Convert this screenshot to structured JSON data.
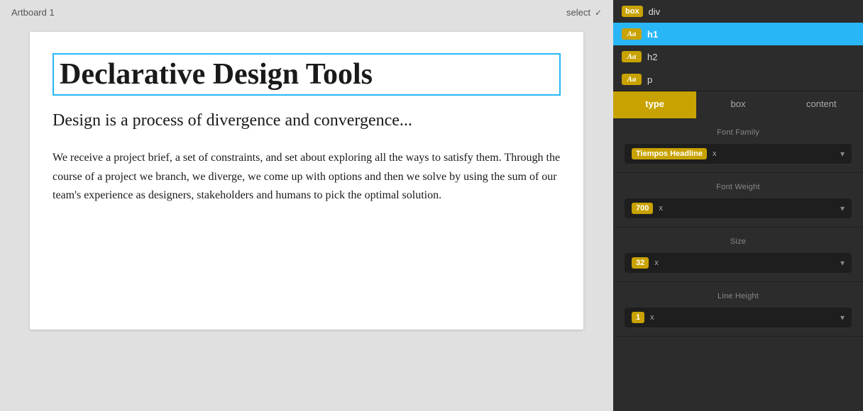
{
  "canvas": {
    "artboard_label": "Artboard 1",
    "select_label": "select",
    "h1_text": "Declarative Design Tools",
    "h2_text": "Design is a process of divergence and convergence...",
    "p_text": "We receive a project brief, a set of constraints, and set about exploring all the ways to satisfy them. Through the course of a project we branch, we diverge, we come up with options and then we solve by using the sum of our team's experience as designers, stakeholders and humans to pick the optimal solution."
  },
  "panel": {
    "elements": [
      {
        "id": "div",
        "badge": "box",
        "label": "div",
        "active": false
      },
      {
        "id": "h1",
        "badge": "Aa",
        "label": "h1",
        "active": true
      },
      {
        "id": "h2",
        "badge": "Aa",
        "label": "h2",
        "active": false
      },
      {
        "id": "p",
        "badge": "Aa",
        "label": "p",
        "active": false
      }
    ],
    "tabs": [
      {
        "id": "type",
        "label": "type",
        "active": true
      },
      {
        "id": "box",
        "label": "box",
        "active": false
      },
      {
        "id": "content",
        "label": "content",
        "active": false
      }
    ],
    "sections": [
      {
        "id": "font-family",
        "label": "Font Family",
        "tag": "Tiempos Headline",
        "x": "x",
        "chevron": "▾"
      },
      {
        "id": "font-weight",
        "label": "Font Weight",
        "tag": "700",
        "x": "x",
        "chevron": "▾"
      },
      {
        "id": "size",
        "label": "Size",
        "tag": "32",
        "x": "x",
        "chevron": "▾"
      },
      {
        "id": "line-height",
        "label": "Line Height",
        "tag": "1",
        "x": "x",
        "chevron": "▾"
      }
    ]
  },
  "colors": {
    "active_tab": "#c8a200",
    "active_row": "#29b6f6",
    "h1_border": "#29b6f6"
  }
}
